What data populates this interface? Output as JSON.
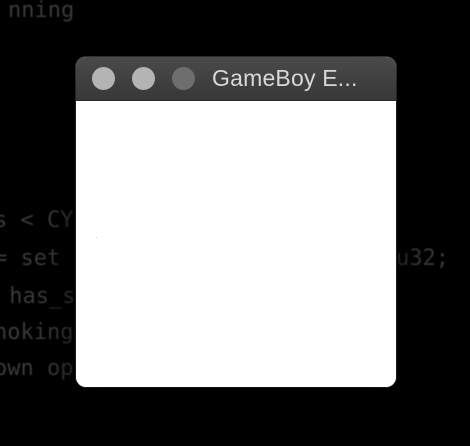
{
  "background": {
    "color": "#000000",
    "code_lines": [
      "nning",
      "s < CY",
      "= set",
      "u32;",
      " has_s",
      "hoking",
      "own op"
    ]
  },
  "window": {
    "title": "GameBoy E...",
    "titlebar_color": "#3f3f3f",
    "content_color": "#ffffff",
    "controls": {
      "close": "close-button",
      "minimize": "minimize-button",
      "zoom": "zoom-button"
    }
  }
}
